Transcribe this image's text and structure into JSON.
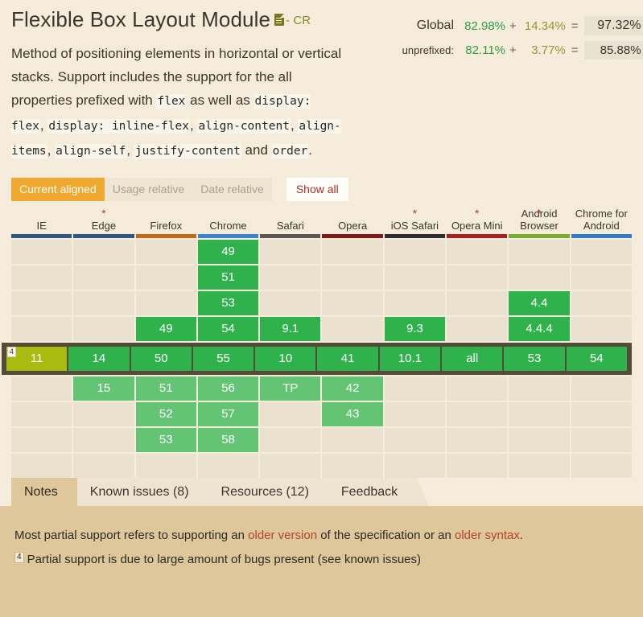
{
  "header": {
    "title": "Flexible Box Layout Module",
    "spec_icon": "spec-document-icon",
    "spec_status": "- CR",
    "description_parts": [
      {
        "t": "text",
        "v": "Method of positioning elements in horizontal or vertical stacks. Support includes the support for the all properties prefixed with "
      },
      {
        "t": "code",
        "v": "flex"
      },
      {
        "t": "text",
        "v": " as well as "
      },
      {
        "t": "code",
        "v": "display: flex"
      },
      {
        "t": "text",
        "v": ", "
      },
      {
        "t": "code",
        "v": "display: inline-flex"
      },
      {
        "t": "text",
        "v": ", "
      },
      {
        "t": "code",
        "v": "align-content"
      },
      {
        "t": "text",
        "v": ", "
      },
      {
        "t": "code",
        "v": "align-items"
      },
      {
        "t": "text",
        "v": ", "
      },
      {
        "t": "code",
        "v": "align-self"
      },
      {
        "t": "text",
        "v": ", "
      },
      {
        "t": "code",
        "v": "justify-content"
      },
      {
        "t": "text",
        "v": " and "
      },
      {
        "t": "code",
        "v": "order"
      },
      {
        "t": "text",
        "v": "."
      }
    ]
  },
  "stats": {
    "rows": [
      {
        "label": "Global",
        "full": "82.98%",
        "op": "+",
        "partial": "14.34%",
        "eq": "=",
        "total": "97.32%"
      },
      {
        "label": "unprefixed:",
        "full": "82.11%",
        "op": "+",
        "partial": "3.77%",
        "eq": "=",
        "total": "85.88%"
      }
    ],
    "colors": {
      "full": "#2e9e44",
      "partial": "#969631",
      "total_bg": "#e9e2d2"
    }
  },
  "controls": {
    "buttons": [
      {
        "label": "Current aligned",
        "active": true
      },
      {
        "label": "Usage relative",
        "active": false
      },
      {
        "label": "Date relative",
        "active": false
      }
    ],
    "show_all": "Show all"
  },
  "table": {
    "columns": [
      {
        "name": "IE",
        "star": false,
        "bar_color": "#31577f",
        "above": [
          "",
          "",
          "",
          ""
        ],
        "current": {
          "value": "11",
          "state": "partial",
          "note": "4"
        },
        "below": [
          "",
          "",
          "",
          ""
        ]
      },
      {
        "name": "Edge",
        "star": true,
        "bar_color": "#31577f",
        "above": [
          "",
          "",
          "",
          ""
        ],
        "current": {
          "value": "14",
          "state": "yes",
          "note": ""
        },
        "below": [
          "15",
          "",
          "",
          ""
        ]
      },
      {
        "name": "Firefox",
        "star": false,
        "bar_color": "#c1681b",
        "above": [
          "",
          "",
          "",
          "49"
        ],
        "current": {
          "value": "50",
          "state": "yes",
          "note": ""
        },
        "below": [
          "51",
          "52",
          "53",
          ""
        ]
      },
      {
        "name": "Chrome",
        "star": false,
        "bar_color": "#3a85cc",
        "above": [
          "49",
          "51",
          "53",
          "54"
        ],
        "current": {
          "value": "55",
          "state": "yes",
          "note": ""
        },
        "below": [
          "56",
          "57",
          "58",
          ""
        ]
      },
      {
        "name": "Safari",
        "star": false,
        "bar_color": "#5c5852",
        "above": [
          "",
          "",
          "",
          "9.1"
        ],
        "current": {
          "value": "10",
          "state": "yes",
          "note": ""
        },
        "below": [
          "TP",
          "",
          "",
          ""
        ]
      },
      {
        "name": "Opera",
        "star": false,
        "bar_color": "#7d1b1b",
        "above": [
          "",
          "",
          "",
          ""
        ],
        "current": {
          "value": "41",
          "state": "yes",
          "note": ""
        },
        "below": [
          "42",
          "43",
          "",
          ""
        ]
      },
      {
        "name": "iOS Safari",
        "star": true,
        "bar_color": "#2e2e2e",
        "above": [
          "",
          "",
          "",
          "9.3"
        ],
        "current": {
          "value": "10.1",
          "state": "yes",
          "note": ""
        },
        "below": [
          "",
          "",
          "",
          ""
        ]
      },
      {
        "name": "Opera Mini",
        "star": true,
        "bar_color": "#a82020",
        "above": [
          "",
          "",
          "",
          ""
        ],
        "current": {
          "value": "all",
          "state": "yes",
          "note": ""
        },
        "below": [
          "",
          "",
          "",
          ""
        ]
      },
      {
        "name": "Android Browser",
        "star": true,
        "bar_color": "#7aac35",
        "above": [
          "",
          "",
          "4.4",
          "4.4.4"
        ],
        "current": {
          "value": "53",
          "state": "yes",
          "note": ""
        },
        "below": [
          "",
          "",
          "",
          ""
        ]
      },
      {
        "name": "Chrome for Android",
        "star": false,
        "bar_color": "#2f7ec4",
        "above": [
          "",
          "",
          "",
          ""
        ],
        "current": {
          "value": "54",
          "state": "yes",
          "note": ""
        },
        "below": [
          "",
          "",
          "",
          ""
        ]
      }
    ]
  },
  "tabs": [
    {
      "label": "Notes",
      "active": true
    },
    {
      "label": "Known issues (8)",
      "active": false
    },
    {
      "label": "Resources (12)",
      "active": false
    },
    {
      "label": "Feedback",
      "active": false
    }
  ],
  "notes": {
    "line1_parts": [
      {
        "t": "text",
        "v": "Most partial support refers to supporting an "
      },
      {
        "t": "link",
        "v": "older version"
      },
      {
        "t": "text",
        "v": " of the specification or an "
      },
      {
        "t": "link",
        "v": "older syntax"
      },
      {
        "t": "text",
        "v": "."
      }
    ],
    "line2_sup": "4",
    "line2": "Partial support is due to large amount of bugs present (see known issues)"
  }
}
